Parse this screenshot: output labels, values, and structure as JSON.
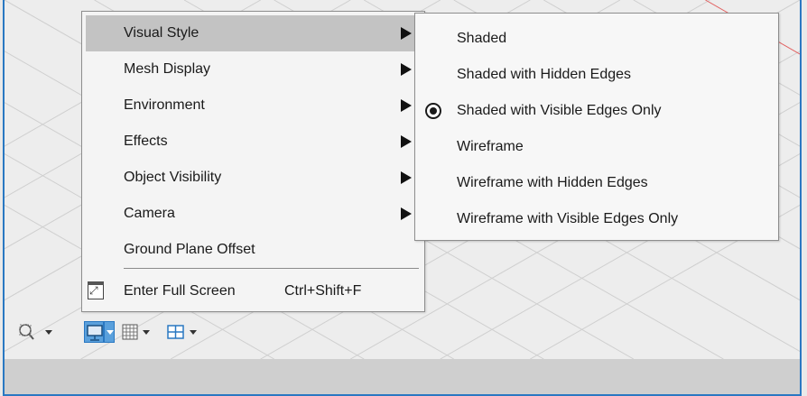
{
  "menu": {
    "items": [
      {
        "label": "Visual Style",
        "has_submenu": true,
        "active": true
      },
      {
        "label": "Mesh Display",
        "has_submenu": true
      },
      {
        "label": "Environment",
        "has_submenu": true
      },
      {
        "label": "Effects",
        "has_submenu": true
      },
      {
        "label": "Object Visibility",
        "has_submenu": true
      },
      {
        "label": "Camera",
        "has_submenu": true
      },
      {
        "label": "Ground Plane Offset",
        "has_submenu": false
      }
    ],
    "fullscreen_label": "Enter Full Screen",
    "fullscreen_shortcut": "Ctrl+Shift+F"
  },
  "submenu": {
    "items": [
      {
        "label": "Shaded"
      },
      {
        "label": "Shaded with Hidden Edges"
      },
      {
        "label": "Shaded with Visible Edges Only",
        "selected": true
      },
      {
        "label": "Wireframe"
      },
      {
        "label": "Wireframe with Hidden Edges"
      },
      {
        "label": "Wireframe with Visible Edges Only"
      }
    ]
  },
  "toolbar": {
    "items": [
      {
        "icon": "zoom-window-icon"
      },
      {
        "icon": "display-settings-icon",
        "active": true
      },
      {
        "icon": "grid-icon"
      },
      {
        "icon": "viewports-icon"
      }
    ]
  },
  "colors": {
    "accent": "#2a78c2",
    "active_menu_bg": "#c3c3c3",
    "axis_red": "#e26060"
  }
}
